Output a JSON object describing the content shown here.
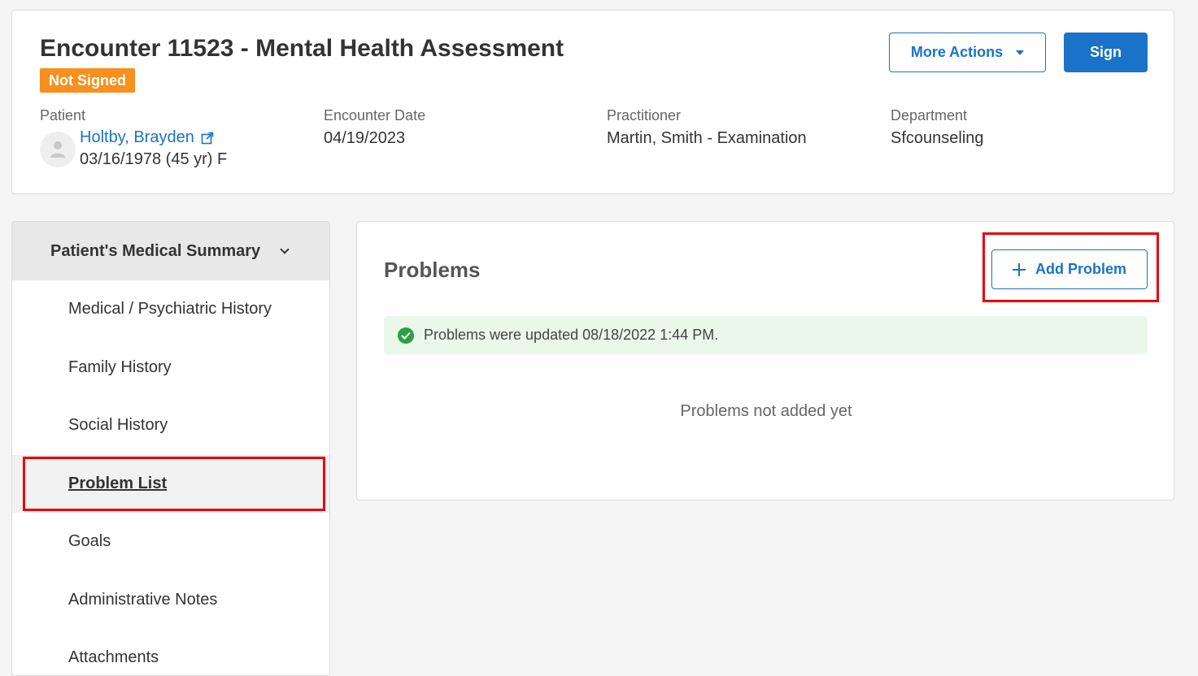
{
  "encounter": {
    "title": "Encounter 11523 - Mental Health Assessment",
    "status": "Not Signed",
    "more_actions_label": "More Actions",
    "sign_label": "Sign",
    "patient_label": "Patient",
    "patient_name": "Holtby, Brayden",
    "patient_dob": "03/16/1978 (45 yr) F",
    "date_label": "Encounter Date",
    "date_value": "04/19/2023",
    "practitioner_label": "Practitioner",
    "practitioner_value": "Martin, Smith - Examination",
    "department_label": "Department",
    "department_value": "Sfcounseling"
  },
  "sidebar": {
    "heading": "Patient's Medical Summary",
    "items": [
      {
        "label": "Medical / Psychiatric History"
      },
      {
        "label": "Family History"
      },
      {
        "label": "Social History"
      },
      {
        "label": "Problem List"
      },
      {
        "label": "Goals"
      },
      {
        "label": "Administrative Notes"
      },
      {
        "label": "Attachments"
      }
    ]
  },
  "problems": {
    "title": "Problems",
    "add_label": "Add Problem",
    "alert_text": "Problems were updated 08/18/2022 1:44 PM.",
    "empty_text": "Problems not added yet"
  },
  "colors": {
    "primary": "#1a73c8",
    "badge": "#f7901e",
    "highlight": "#e8000b",
    "success": "#2e9e48"
  }
}
